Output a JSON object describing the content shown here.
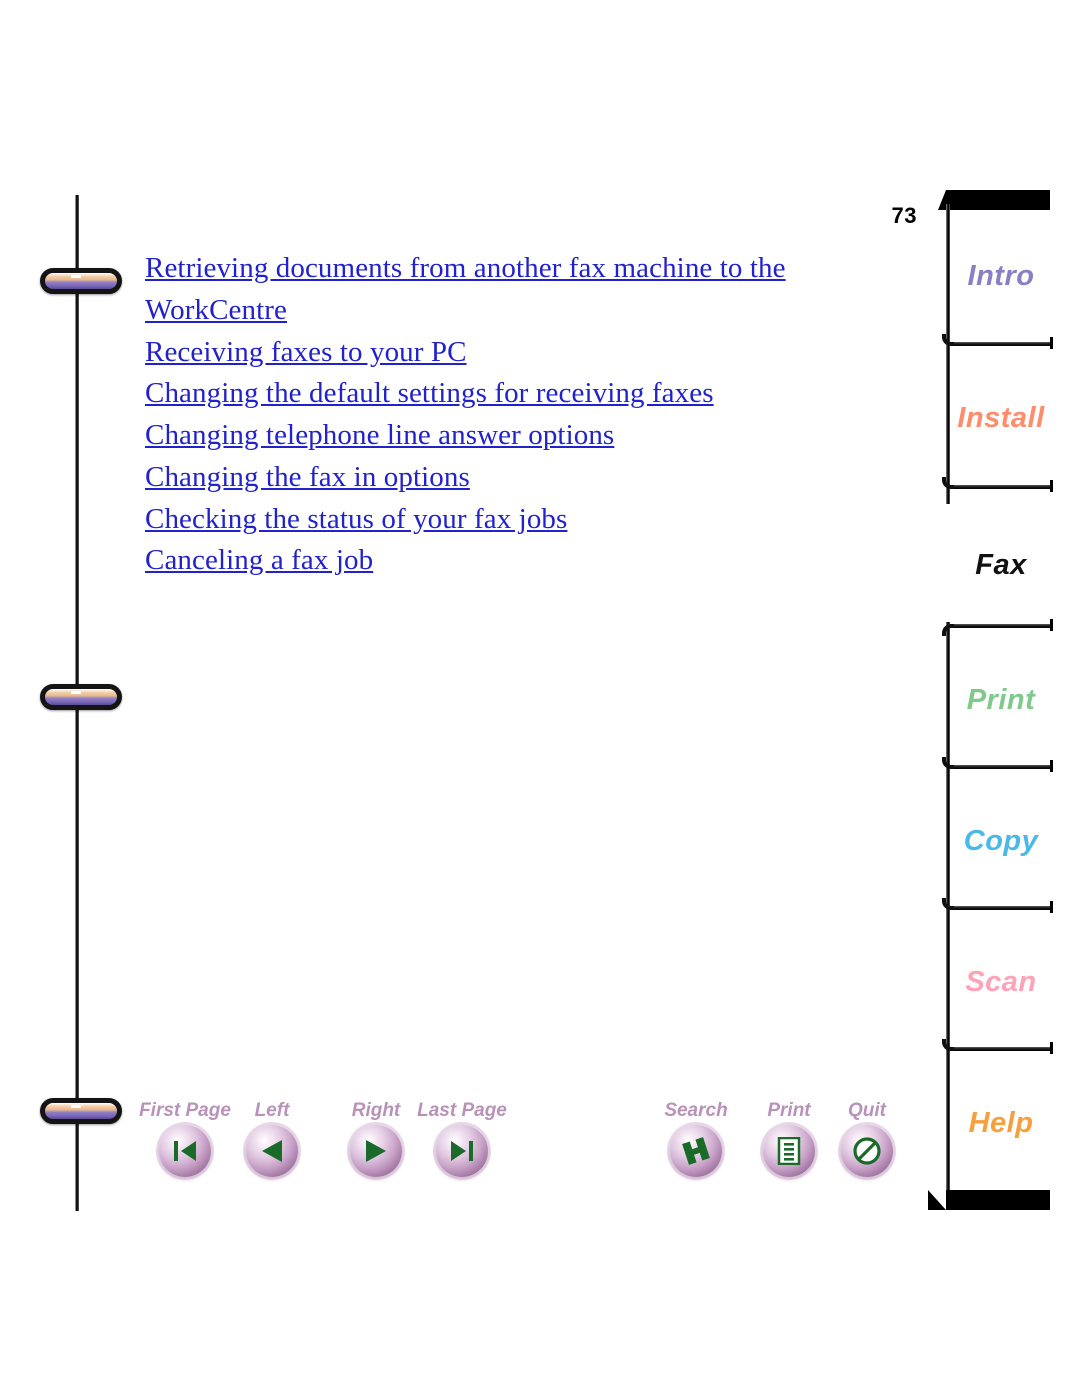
{
  "document": {
    "page_number": "73",
    "section": "Fax",
    "link_color": "#2222cc"
  },
  "toc": {
    "links": [
      {
        "label": "Retrieving documents from another fax machine to the WorkCentre"
      },
      {
        "label": "Receiving faxes to your PC"
      },
      {
        "label": "Changing the default settings for receiving faxes"
      },
      {
        "label": "Changing telephone line answer options"
      },
      {
        "label": "Changing the fax in options"
      },
      {
        "label": "Checking the status of your fax jobs"
      },
      {
        "label": "Canceling a fax job"
      }
    ]
  },
  "tabs": {
    "items": [
      {
        "label": "Intro",
        "color": "#8a7fc4",
        "selected": false
      },
      {
        "label": "Install",
        "color": "#ff8c6b",
        "selected": false
      },
      {
        "label": "Fax",
        "color": "#111111",
        "selected": true
      },
      {
        "label": "Print",
        "color": "#7fc98c",
        "selected": false
      },
      {
        "label": "Copy",
        "color": "#4bb8e8",
        "selected": false
      },
      {
        "label": "Scan",
        "color": "#ffa3b8",
        "selected": false
      },
      {
        "label": "Help",
        "color": "#f5a03c",
        "selected": false
      }
    ]
  },
  "toolbar": {
    "buttons": [
      {
        "label": "First Page",
        "icon": "first-page-icon"
      },
      {
        "label": "Left",
        "icon": "previous-page-icon"
      },
      {
        "label": "Right",
        "icon": "next-page-icon"
      },
      {
        "label": "Last Page",
        "icon": "last-page-icon"
      },
      {
        "label": "Search",
        "icon": "search-icon"
      },
      {
        "label": "Print",
        "icon": "print-icon"
      },
      {
        "label": "Quit",
        "icon": "quit-icon"
      }
    ],
    "caption_color": "#b992b9",
    "glyph_color": "#1a6b2a"
  },
  "binder": {
    "ring_count": 3
  }
}
